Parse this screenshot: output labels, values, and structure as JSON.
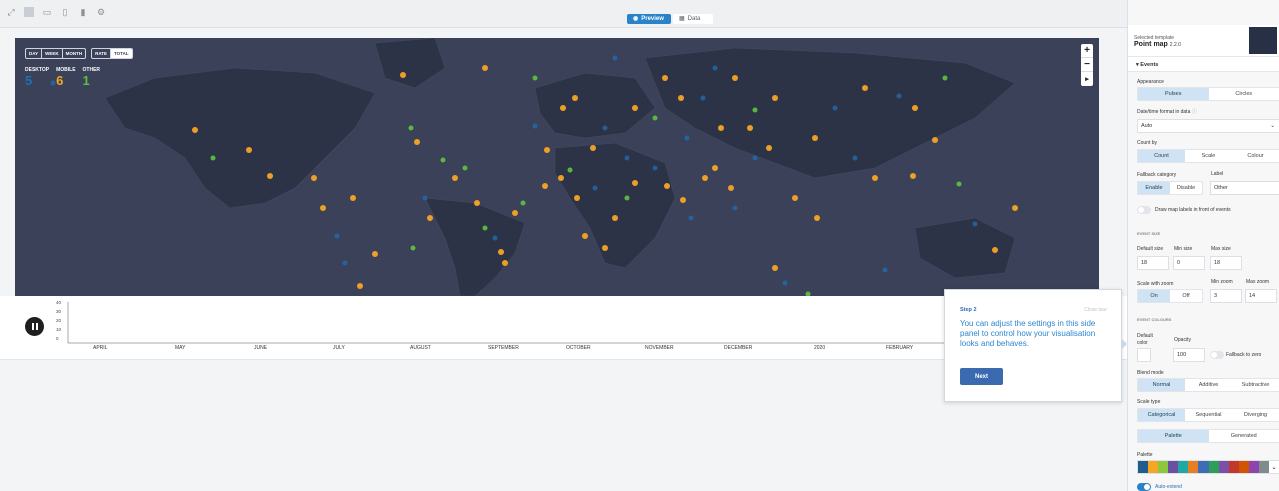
{
  "toolbar": {
    "icons": [
      "expand-icon",
      "desktop-icon",
      "tablet-icon",
      "phone-icon",
      "settings-icon"
    ],
    "tabs": [
      {
        "label": "Preview",
        "icon": "eye-icon",
        "active": true
      },
      {
        "label": "Data",
        "icon": "grid-icon",
        "active": false
      }
    ]
  },
  "map": {
    "period_filters": [
      "DAY",
      "WEEK",
      "MONTH"
    ],
    "period_selected": "",
    "mode_filters": [
      "RATE",
      "TOTAL"
    ],
    "mode_selected": "TOTAL",
    "legend": [
      {
        "label": "DESKTOP",
        "value": "5",
        "color": "#1f6fb5"
      },
      {
        "label": "MOBILE",
        "value": "6",
        "color": "#f5a623"
      },
      {
        "label": "OTHER",
        "value": "1",
        "color": "#5cbf3f"
      }
    ],
    "zoom": {
      "in": "+",
      "out": "−",
      "reset": "▸"
    },
    "colors": {
      "land": "#2d3346",
      "water": "#3a4158"
    }
  },
  "timeline": {
    "y_ticks": [
      "40",
      "30",
      "20",
      "10",
      "0"
    ],
    "months": [
      "APRIL",
      "MAY",
      "JUNE",
      "JULY",
      "AUGUST",
      "SEPTEMBER",
      "OCTOBER",
      "NOVEMBER",
      "DECEMBER",
      "2020",
      "FEBRUARY"
    ],
    "state": "playing"
  },
  "panel": {
    "template_caption": "Selected template",
    "template_name": "Point map",
    "template_version": "2.2.0",
    "section": "Events",
    "appearance": {
      "label": "Appearance",
      "options": [
        "Pulses",
        "Circles"
      ],
      "selected": "Pulses"
    },
    "datetime": {
      "label": "Date/time format in data",
      "value": "Auto"
    },
    "count_by": {
      "label": "Count by",
      "options": [
        "Count",
        "Scale",
        "Colour"
      ],
      "selected": "Count"
    },
    "fallback": {
      "label": "Fallback category",
      "options": [
        "Enable",
        "Disable"
      ],
      "selected": "Enable",
      "label_field_caption": "Label",
      "label_value": "Other"
    },
    "draw_labels": "Draw map labels in front of events",
    "event_size": {
      "heading": "EVENT SIZE",
      "default_label": "Default size",
      "default_value": "18",
      "min_label": "Min size",
      "min_value": "0",
      "max_label": "Max size",
      "max_value": "18"
    },
    "scale_zoom": {
      "label": "Scale with zoom",
      "options": [
        "On",
        "Off"
      ],
      "selected": "On",
      "min_label": "Min zoom",
      "min_value": "3",
      "max_label": "Max zoom",
      "max_value": "14"
    },
    "event_colours": {
      "heading": "EVENT COLOURS",
      "default_label": "Default color",
      "opacity_label": "Opacity",
      "opacity_value": "100",
      "fallback_zero": "Fallback to zero"
    },
    "blend": {
      "label": "Blend mode",
      "options": [
        "Normal",
        "Additive",
        "Subtractive"
      ],
      "selected": "Normal"
    },
    "scale_type": {
      "label": "Scale type",
      "options": [
        "Categorical",
        "Sequential",
        "Diverging"
      ],
      "selected": "Categorical"
    },
    "palette_mode": {
      "options": [
        "Palette",
        "Generated"
      ],
      "selected": "Palette"
    },
    "palette": {
      "label": "Palette",
      "colors": [
        "#1f5d8c",
        "#f5a623",
        "#8dc63f",
        "#6b4fa0",
        "#1fa7a3",
        "#e67e22",
        "#3d6db5",
        "#2e9e5b",
        "#7e4fa8",
        "#c0392b",
        "#d35400",
        "#8e44ad",
        "#7f8c8d"
      ]
    },
    "auto_extend": "Auto-extend"
  },
  "tour": {
    "step": "Step 2",
    "close": "Close tour",
    "message": "You can adjust the settings in this side panel to control how your visualisation looks and behaves.",
    "next": "Next"
  }
}
